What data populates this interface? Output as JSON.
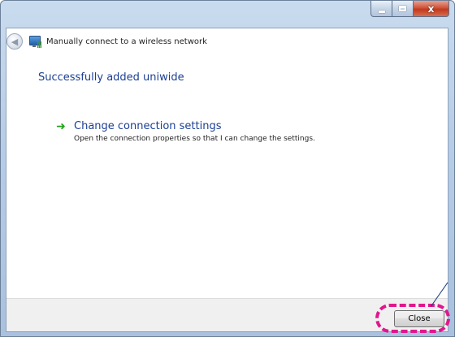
{
  "window": {
    "title": "Manually connect to a wireless network",
    "caption_close_glyph": "x"
  },
  "main": {
    "status_title": "Successfully added uniwide",
    "link": {
      "label": "Change connection settings",
      "description": "Open the connection properties so that I can change the settings."
    }
  },
  "footer": {
    "close_label": "Close"
  },
  "icons": {
    "back": "back-arrow-icon",
    "network": "wireless-network-icon",
    "link_arrow": "green-arrow-icon"
  },
  "colors": {
    "link_blue": "#1b3f94",
    "arrow_green": "#21a31b",
    "highlight_magenta": "#e0178e"
  }
}
